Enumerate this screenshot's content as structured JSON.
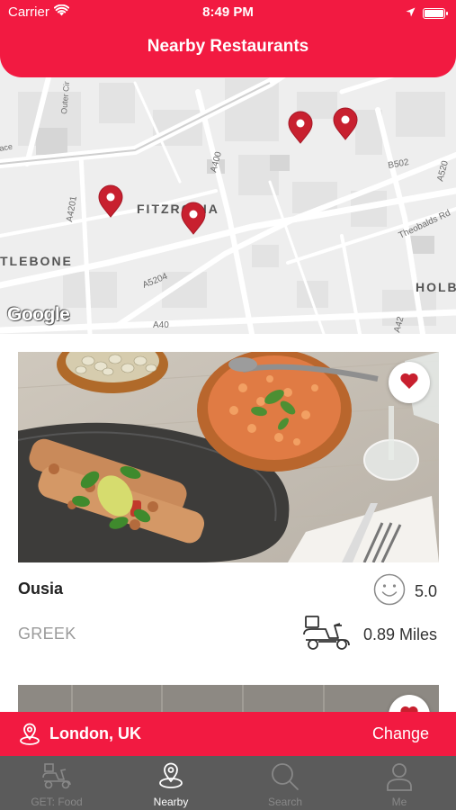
{
  "status_bar": {
    "carrier": "Carrier",
    "time": "8:49 PM"
  },
  "header": {
    "title": "Nearby Restaurants"
  },
  "map": {
    "attribution": "Google",
    "labels": {
      "fitzrovia": "FITZROVIA",
      "marylebone": "TLEBONE",
      "holborn": "HOLB",
      "a400": "A400",
      "a4201": "A4201",
      "a5204": "A5204",
      "a40": "A40",
      "b502": "B502",
      "a5200": "A520",
      "a4200": "A42",
      "theobalds": "Theobalds Rd",
      "outer_circle": "Outer Cir",
      "place": "ace"
    },
    "marker_color": "#c8202f"
  },
  "restaurants": [
    {
      "name": "Ousia",
      "rating": "5.0",
      "cuisine": "GREEK",
      "distance": "0.89 Miles",
      "favorite": true
    },
    {
      "favorite": true
    }
  ],
  "location_bar": {
    "place": "London, UK",
    "change_label": "Change"
  },
  "tabs": [
    {
      "label": "GET: Food",
      "icon": "delivery-scooter-icon",
      "active": false
    },
    {
      "label": "Nearby",
      "icon": "map-pin-icon",
      "active": true
    },
    {
      "label": "Search",
      "icon": "search-icon",
      "active": false
    },
    {
      "label": "Me",
      "icon": "person-icon",
      "active": false
    }
  ],
  "colors": {
    "brand": "#f21a41",
    "tabbar": "#5b5b5b",
    "heart": "#c8202f"
  }
}
